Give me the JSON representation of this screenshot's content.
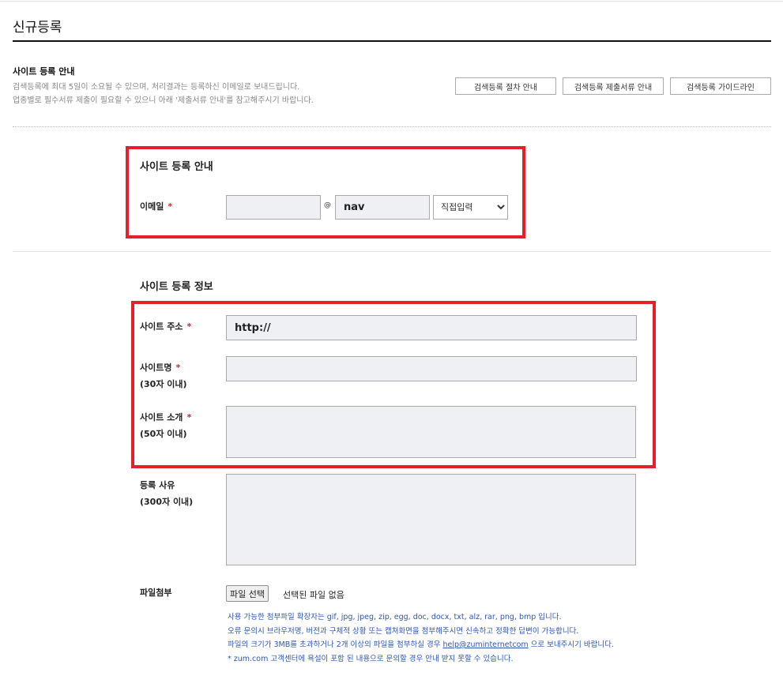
{
  "page": {
    "title": "신규등록"
  },
  "guide": {
    "heading": "사이트 등록 안내",
    "line1": "검색등록에 최대 5일이 소요될 수 있으며, 처리결과는 등록하신 이메일로 보내드립니다.",
    "line2": "업종별로 필수서류 제출이 필요할 수 있으니 아래 '제출서류 안내'를 참고해주시기 바랍니다.",
    "buttons": [
      "검색등록 절차 안내",
      "검색등록 제출서류 안내",
      "검색등록 가이드라인"
    ]
  },
  "email_section": {
    "title": "사이트 등록 안내",
    "label": "이메일",
    "required_mark": "*",
    "at": "@",
    "domain_value": "nav",
    "select_value": "직접입력"
  },
  "info_section": {
    "title": "사이트 등록 정보",
    "site_url": {
      "label": "사이트 주소",
      "value": "http://"
    },
    "site_name": {
      "label": "사이트명",
      "sub": "(30자 이내)"
    },
    "site_intro": {
      "label": "사이트 소개",
      "sub": "(50자 이내)"
    },
    "reason": {
      "label": "등록 사유",
      "sub": "(300자 이내)"
    }
  },
  "file": {
    "label": "파일첨부",
    "button": "파일 선택",
    "status": "선택된 파일 없음",
    "notes": [
      "사용 가능한 첨부파일 확장자는 gif, jpg, jpeg, zip, egg, doc, docx, txt, alz, rar, png, bmp 입니다.",
      "오류 문의시 브라우저명, 버전과 구체적 상황 또는 캡쳐화면을 첨부해주시면 신속하고 정확한 답변이 가능합니다."
    ],
    "note3_pre": "파일의 크기가 3MB를 초과하거나 2개 이상의 파일을 첨부하실 경우 ",
    "note3_email": "help@zuminternetcom",
    "note3_post": " 으로 보내주시기 바랍니다.",
    "note4": " * zum.com 고객센터에 욕설이 포함 된 내용으로 문의할 경우 안내 받지 못할 수 있습니다."
  }
}
